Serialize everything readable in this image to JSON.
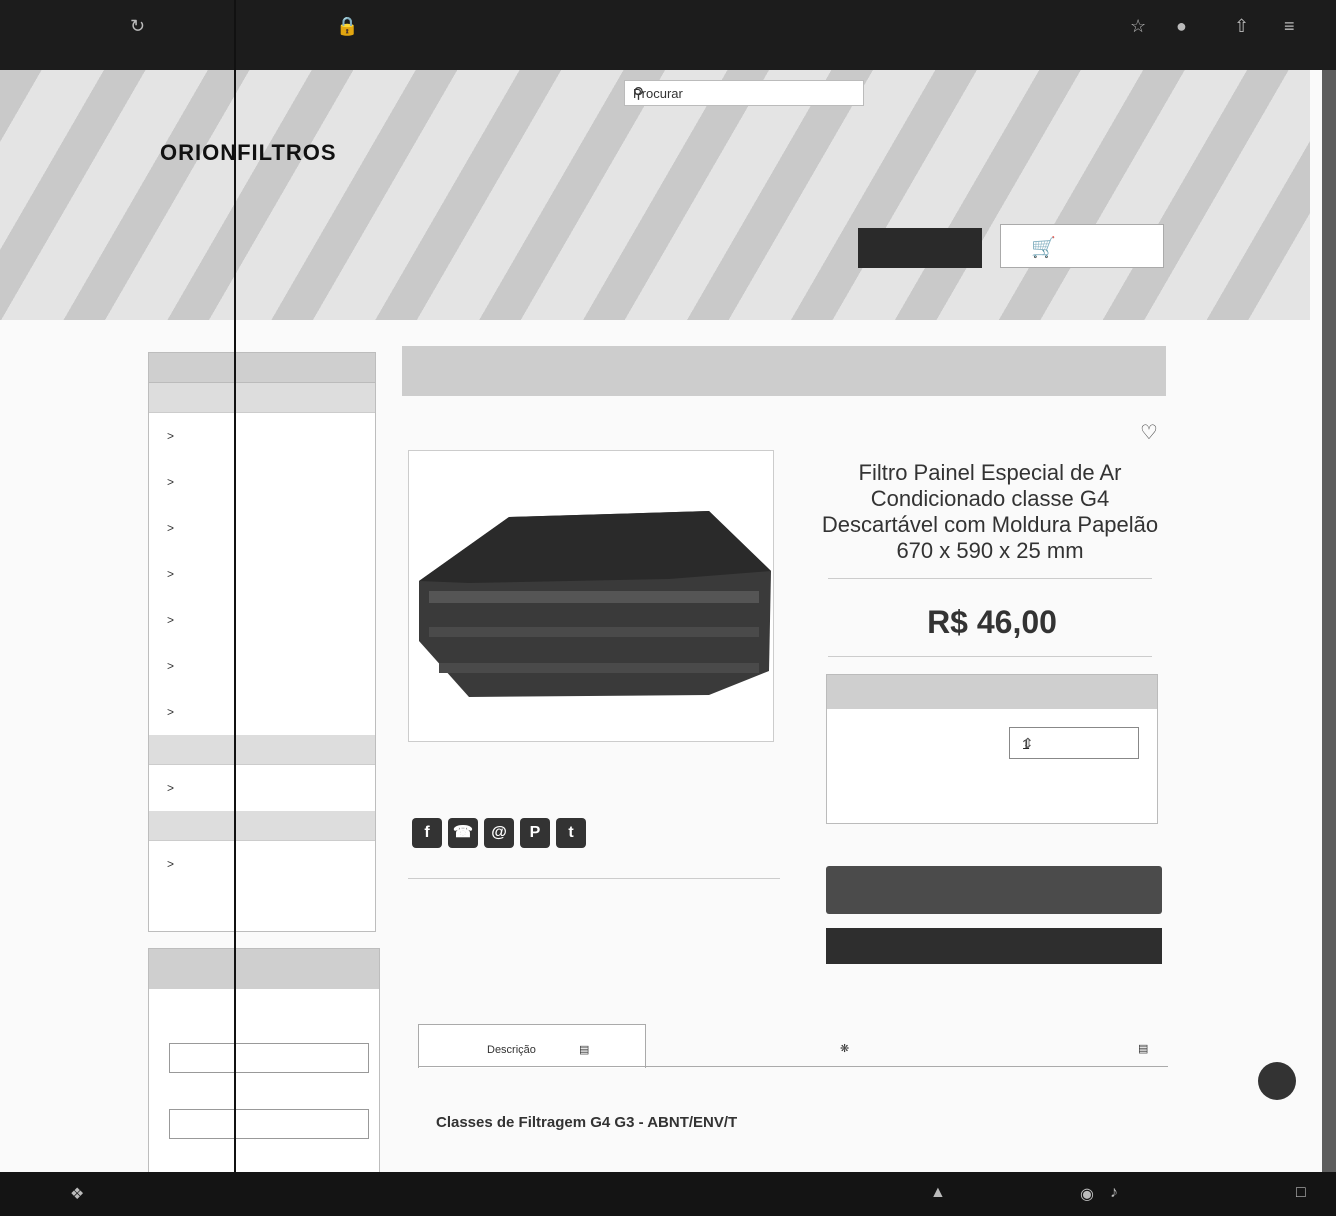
{
  "search": {
    "placeholder": "Procurar"
  },
  "store": {
    "logo": "ORIONFILTROS"
  },
  "product": {
    "title": "Filtro Painel Especial de Ar Condicionado classe G4 Descartável com Moldura Papelão 670 x 590 x 25 mm",
    "price": "R$ 46,00",
    "quantity": "1"
  },
  "tabs": {
    "description": "Descrição"
  },
  "content": {
    "heading": "Classes de Filtragem G4 G3 - ABNT/ENV/T"
  },
  "colors": {
    "header_bg": "#1c1c1c",
    "panel_gray": "#cfcfcf",
    "button_dark": "#2e2e2e"
  }
}
